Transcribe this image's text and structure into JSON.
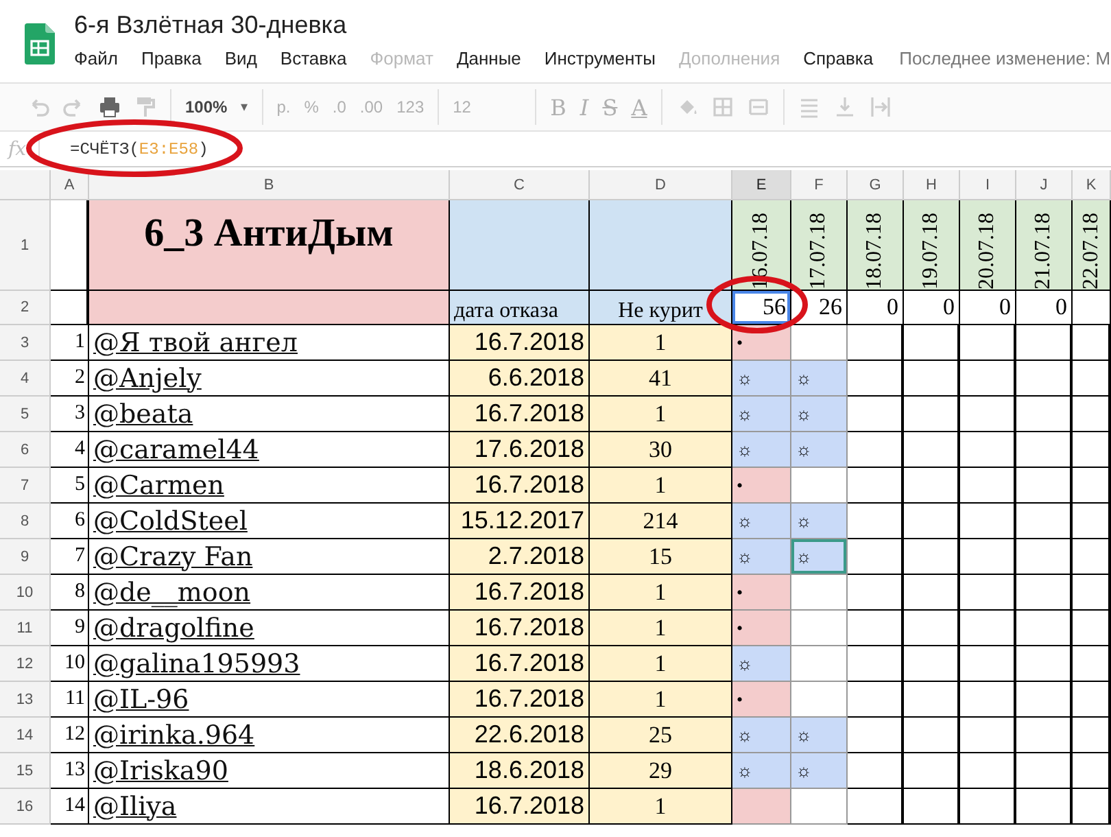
{
  "app": {
    "title": "6-я Взлётная 30-дневка",
    "last_edit": "Последнее изменение: М"
  },
  "menu": [
    {
      "label": "Файл",
      "disabled": false
    },
    {
      "label": "Правка",
      "disabled": false
    },
    {
      "label": "Вид",
      "disabled": false
    },
    {
      "label": "Вставка",
      "disabled": false
    },
    {
      "label": "Формат",
      "disabled": true
    },
    {
      "label": "Данные",
      "disabled": false
    },
    {
      "label": "Инструменты",
      "disabled": false
    },
    {
      "label": "Дополнения",
      "disabled": true
    },
    {
      "label": "Справка",
      "disabled": false
    }
  ],
  "toolbar": {
    "zoom": "100%",
    "zoom_caret": "▾",
    "formats": [
      "р.",
      "%",
      ".0",
      ".00",
      "123"
    ],
    "font_size": "12",
    "styles": [
      "B",
      "I",
      "S",
      "A"
    ]
  },
  "formula": {
    "fx": "fx",
    "prefix": "=СЧЁТЗ(",
    "range": "E3:E58",
    "suffix": ")"
  },
  "columns": [
    "A",
    "B",
    "C",
    "D",
    "E",
    "F",
    "G",
    "H",
    "I",
    "J",
    "K"
  ],
  "header": {
    "row_numbers": [
      "1",
      "2"
    ],
    "title": "6_3 АнтиДым",
    "date_label": "дата отказа",
    "days_label": "Не курит",
    "dates": [
      "16.07.18",
      "17.07.18",
      "18.07.18",
      "19.07.18",
      "20.07.18",
      "21.07.18",
      "22.07.18"
    ],
    "counts": [
      {
        "value": "56",
        "selected": true
      },
      {
        "value": "26",
        "selected": false
      },
      {
        "value": "0",
        "selected": false
      },
      {
        "value": "0",
        "selected": false
      },
      {
        "value": "0",
        "selected": false
      },
      {
        "value": "0",
        "selected": false
      }
    ]
  },
  "rows": [
    {
      "row": "3",
      "num": "1",
      "name": "@Я твой ангел",
      "date": "16.7.2018",
      "days": "1",
      "marks": [
        {
          "kind": "dot",
          "mark": "•",
          "selected": false
        }
      ]
    },
    {
      "row": "4",
      "num": "2",
      "name": "@Anjely",
      "date": "6.6.2018",
      "days": "41",
      "marks": [
        {
          "kind": "sun",
          "mark": "☼",
          "selected": false
        },
        {
          "kind": "sun",
          "mark": "☼",
          "selected": false
        }
      ]
    },
    {
      "row": "5",
      "num": "3",
      "name": "@beata",
      "date": "16.7.2018",
      "days": "1",
      "marks": [
        {
          "kind": "sun",
          "mark": "☼",
          "selected": false
        },
        {
          "kind": "sun",
          "mark": "☼",
          "selected": false
        }
      ]
    },
    {
      "row": "6",
      "num": "4",
      "name": "@caramel44",
      "date": "17.6.2018",
      "days": "30",
      "marks": [
        {
          "kind": "sun",
          "mark": "☼",
          "selected": false
        },
        {
          "kind": "sun",
          "mark": "☼",
          "selected": false
        }
      ]
    },
    {
      "row": "7",
      "num": "5",
      "name": "@Carmen",
      "date": "16.7.2018",
      "days": "1",
      "marks": [
        {
          "kind": "dot",
          "mark": "•",
          "selected": false
        }
      ]
    },
    {
      "row": "8",
      "num": "6",
      "name": "@ColdSteel",
      "date": "15.12.2017",
      "days": "214",
      "marks": [
        {
          "kind": "sun",
          "mark": "☼",
          "selected": false
        },
        {
          "kind": "sun",
          "mark": "☼",
          "selected": false
        }
      ]
    },
    {
      "row": "9",
      "num": "7",
      "name": "@Crazy Fan",
      "date": "2.7.2018",
      "days": "15",
      "marks": [
        {
          "kind": "sun",
          "mark": "☼",
          "selected": false
        },
        {
          "kind": "sun",
          "mark": "☼",
          "selected": true
        }
      ]
    },
    {
      "row": "10",
      "num": "8",
      "name": "@de__moon",
      "date": "16.7.2018",
      "days": "1",
      "marks": [
        {
          "kind": "dot",
          "mark": "•",
          "selected": false
        }
      ]
    },
    {
      "row": "11",
      "num": "9",
      "name": "@dragolfine",
      "date": "16.7.2018",
      "days": "1",
      "marks": [
        {
          "kind": "dot",
          "mark": "•",
          "selected": false
        }
      ]
    },
    {
      "row": "12",
      "num": "10",
      "name": "@galina195993",
      "date": "16.7.2018",
      "days": "1",
      "marks": [
        {
          "kind": "sun",
          "mark": "☼",
          "selected": false
        }
      ]
    },
    {
      "row": "13",
      "num": "11",
      "name": "@IL-96",
      "date": "16.7.2018",
      "days": "1",
      "marks": [
        {
          "kind": "dot",
          "mark": "•",
          "selected": false
        }
      ]
    },
    {
      "row": "14",
      "num": "12",
      "name": "@irinka.964",
      "date": "22.6.2018",
      "days": "25",
      "marks": [
        {
          "kind": "sun",
          "mark": "☼",
          "selected": false
        },
        {
          "kind": "sun",
          "mark": "☼",
          "selected": false
        }
      ]
    },
    {
      "row": "15",
      "num": "13",
      "name": "@Iriska90",
      "date": "18.6.2018",
      "days": "29",
      "marks": [
        {
          "kind": "sun",
          "mark": "☼",
          "selected": false
        },
        {
          "kind": "sun",
          "mark": "☼",
          "selected": false
        }
      ]
    },
    {
      "row": "16",
      "num": "14",
      "name": "@Iliya",
      "date": "16.7.2018",
      "days": "1",
      "marks": [
        {
          "kind": "dot",
          "selected": false
        }
      ]
    }
  ]
}
